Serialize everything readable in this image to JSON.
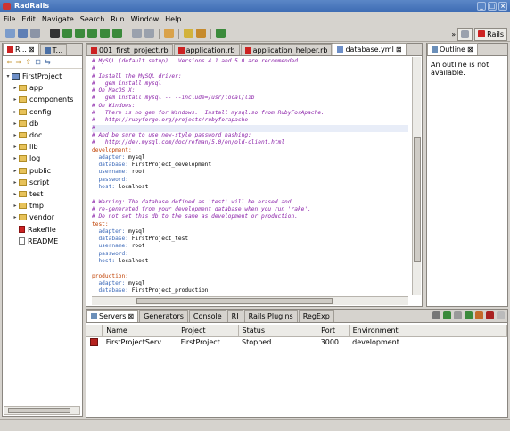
{
  "window": {
    "title": "RadRails"
  },
  "menu": [
    "File",
    "Edit",
    "Navigate",
    "Search",
    "Run",
    "Window",
    "Help"
  ],
  "perspective": {
    "label": "Rails",
    "chevron": "»"
  },
  "left_panel": {
    "tabs": [
      "R...",
      "T..."
    ],
    "tree": [
      {
        "label": "FirstProject",
        "type": "project",
        "expanded": true,
        "depth": 0
      },
      {
        "label": "app",
        "type": "folder",
        "depth": 1
      },
      {
        "label": "components",
        "type": "folder",
        "depth": 1
      },
      {
        "label": "config",
        "type": "folder",
        "depth": 1
      },
      {
        "label": "db",
        "type": "folder",
        "depth": 1
      },
      {
        "label": "doc",
        "type": "folder",
        "depth": 1
      },
      {
        "label": "lib",
        "type": "folder",
        "depth": 1
      },
      {
        "label": "log",
        "type": "folder",
        "depth": 1
      },
      {
        "label": "public",
        "type": "folder",
        "depth": 1
      },
      {
        "label": "script",
        "type": "folder",
        "depth": 1
      },
      {
        "label": "test",
        "type": "folder",
        "depth": 1
      },
      {
        "label": "tmp",
        "type": "folder",
        "depth": 1
      },
      {
        "label": "vendor",
        "type": "folder",
        "depth": 1
      },
      {
        "label": "Rakefile",
        "type": "rake",
        "depth": 1
      },
      {
        "label": "README",
        "type": "file",
        "depth": 1
      }
    ]
  },
  "editor": {
    "tabs": [
      "001_first_project.rb",
      "application.rb",
      "application_helper.rb",
      "database.yml"
    ],
    "active_tab": 3,
    "lines": [
      {
        "t": "# MySQL (default setup).  Versions 4.1 and 5.0 are recommended",
        "c": "cm"
      },
      {
        "t": "#",
        "c": "cm"
      },
      {
        "t": "# Install the MySQL driver:",
        "c": "cm"
      },
      {
        "t": "#   gem install mysql",
        "c": "cm"
      },
      {
        "t": "# On MacOS X:",
        "c": "cm"
      },
      {
        "t": "#   gem install mysql -- --include=/usr/local/lib",
        "c": "cm"
      },
      {
        "t": "# On Windows:",
        "c": "cm"
      },
      {
        "t": "#   There is no gem for Windows.  Install mysql.so from RubyForApache.",
        "c": "cm"
      },
      {
        "t": "#   http://rubyforge.org/projects/rubyforapache",
        "c": "cm"
      },
      {
        "t": "#",
        "c": "cm hl"
      },
      {
        "t": "# And be sure to use new-style password hashing:",
        "c": "cm"
      },
      {
        "t": "#   http://dev.mysql.com/doc/refman/5.0/en/old-client.html",
        "c": "cm"
      },
      {
        "t": "development:",
        "c": "ky"
      },
      {
        "k": "  adapter:",
        "v": " mysql"
      },
      {
        "k": "  database:",
        "v": " FirstProject_development"
      },
      {
        "k": "  username:",
        "v": " root"
      },
      {
        "k": "  password:",
        "v": ""
      },
      {
        "k": "  host:",
        "v": " localhost"
      },
      {
        "t": "",
        "c": ""
      },
      {
        "t": "# Warning: The database defined as 'test' will be erased and",
        "c": "cm"
      },
      {
        "t": "# re-generated from your development database when you run 'rake'.",
        "c": "cm"
      },
      {
        "t": "# Do not set this db to the same as development or production.",
        "c": "cm"
      },
      {
        "t": "test:",
        "c": "ky"
      },
      {
        "k": "  adapter:",
        "v": " mysql"
      },
      {
        "k": "  database:",
        "v": " FirstProject_test"
      },
      {
        "k": "  username:",
        "v": " root"
      },
      {
        "k": "  password:",
        "v": ""
      },
      {
        "k": "  host:",
        "v": " localhost"
      },
      {
        "t": "",
        "c": ""
      },
      {
        "t": "production:",
        "c": "ky"
      },
      {
        "k": "  adapter:",
        "v": " mysql"
      },
      {
        "k": "  database:",
        "v": " FirstProject_production"
      }
    ]
  },
  "outline": {
    "tab": "Outline",
    "message": "An outline is not available."
  },
  "bottom_panel": {
    "tabs": [
      "Servers",
      "Generators",
      "Console",
      "RI",
      "Rails Plugins",
      "RegExp"
    ],
    "columns": [
      "Name",
      "Project",
      "Status",
      "Port",
      "Environment"
    ],
    "rows": [
      [
        "FirstProjectServ",
        "FirstProject",
        "Stopped",
        "3000",
        "development"
      ]
    ]
  }
}
